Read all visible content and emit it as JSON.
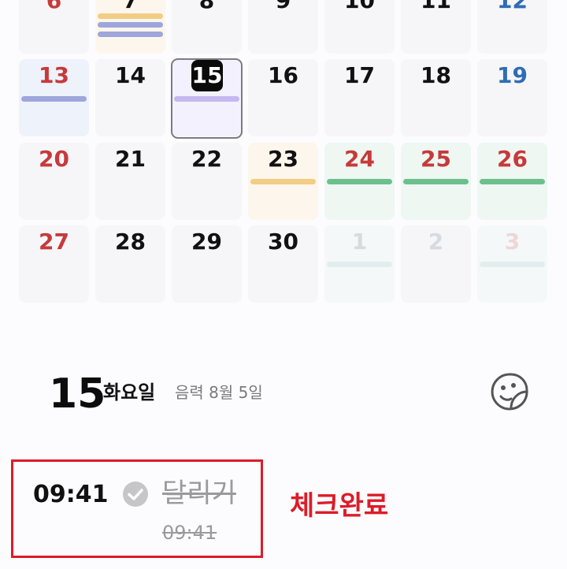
{
  "calendar": {
    "partial_row": [
      {
        "day": "6",
        "color": "#c73a3a"
      },
      {
        "day": "7",
        "color": "#111111"
      },
      {
        "day": "8",
        "color": "#111111"
      },
      {
        "day": "9",
        "color": "#111111"
      },
      {
        "day": "10",
        "color": "#111111"
      },
      {
        "day": "11",
        "color": "#111111"
      },
      {
        "day": "12",
        "color": "#2f6db3"
      }
    ],
    "weeks": [
      [
        "13",
        "14",
        "15",
        "16",
        "17",
        "18",
        "19"
      ],
      [
        "20",
        "21",
        "22",
        "23",
        "24",
        "25",
        "26"
      ],
      [
        "27",
        "28",
        "29",
        "30",
        "1",
        "2",
        "3"
      ]
    ],
    "today": "15"
  },
  "detail": {
    "day": "15",
    "weekday": "화요일",
    "lunar": "음력 8월 5일"
  },
  "event": {
    "time": "09:41",
    "title": "달리기",
    "completed_time": "09:41",
    "completed": true
  },
  "annotation": {
    "label": "체크완료",
    "color": "#dc1c28"
  },
  "colors": {
    "sunday": "#c73a3a",
    "saturday": "#2f6db3",
    "event_purple": "#9ea6dc",
    "event_yellow": "#f1cd85",
    "event_green": "#6cc08c",
    "today_bar": "#c4b8f0"
  }
}
